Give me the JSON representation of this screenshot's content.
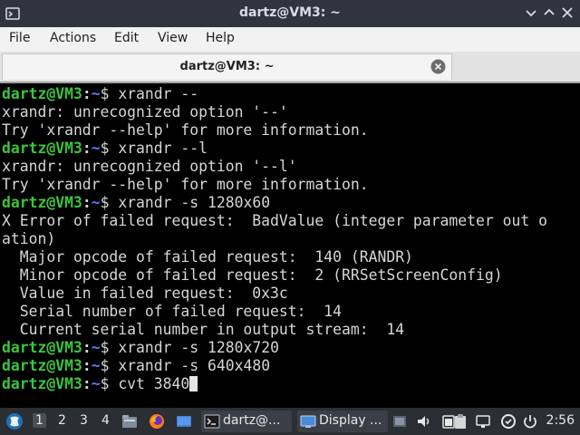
{
  "window": {
    "title": "dartz@VM3: ~"
  },
  "menu": {
    "items": [
      "File",
      "Actions",
      "Edit",
      "View",
      "Help"
    ]
  },
  "tab": {
    "label": "dartz@VM3: ~"
  },
  "terminal": {
    "prompt_user": "dartz@VM3",
    "prompt_sep": ":",
    "prompt_path": "~",
    "prompt_suffix": "$ ",
    "lines": [
      {
        "type": "cmd",
        "text": "xrandr --"
      },
      {
        "type": "out",
        "text": "xrandr: unrecognized option '--'"
      },
      {
        "type": "out",
        "text": "Try 'xrandr --help' for more information."
      },
      {
        "type": "cmd",
        "text": "xrandr --l"
      },
      {
        "type": "out",
        "text": "xrandr: unrecognized option '--l'"
      },
      {
        "type": "out",
        "text": "Try 'xrandr --help' for more information."
      },
      {
        "type": "cmd",
        "text": "xrandr -s 1280x60"
      },
      {
        "type": "out",
        "text": "X Error of failed request:  BadValue (integer parameter out o"
      },
      {
        "type": "out",
        "text": "ation)"
      },
      {
        "type": "out",
        "text": "  Major opcode of failed request:  140 (RANDR)"
      },
      {
        "type": "out",
        "text": "  Minor opcode of failed request:  2 (RRSetScreenConfig)"
      },
      {
        "type": "out",
        "text": "  Value in failed request:  0x3c"
      },
      {
        "type": "out",
        "text": "  Serial number of failed request:  14"
      },
      {
        "type": "out",
        "text": "  Current serial number in output stream:  14"
      },
      {
        "type": "cmd",
        "text": "xrandr -s 1280x720"
      },
      {
        "type": "cmd",
        "text": "xrandr -s 640x480"
      },
      {
        "type": "cmd",
        "text": "cvt 3840",
        "cursor": true
      }
    ]
  },
  "taskbar": {
    "workspaces": [
      "1",
      "2",
      "3",
      "4"
    ],
    "active_workspace": "1",
    "tasks": [
      {
        "label": "dartz@...",
        "icon": "terminal-icon"
      },
      {
        "label": "Display ...",
        "icon": "display-icon"
      }
    ],
    "clock": "2:56",
    "colors": {
      "panel": "#2b2e33",
      "prompt_user": "#3cc43c",
      "prompt_path": "#5a7cff"
    }
  }
}
